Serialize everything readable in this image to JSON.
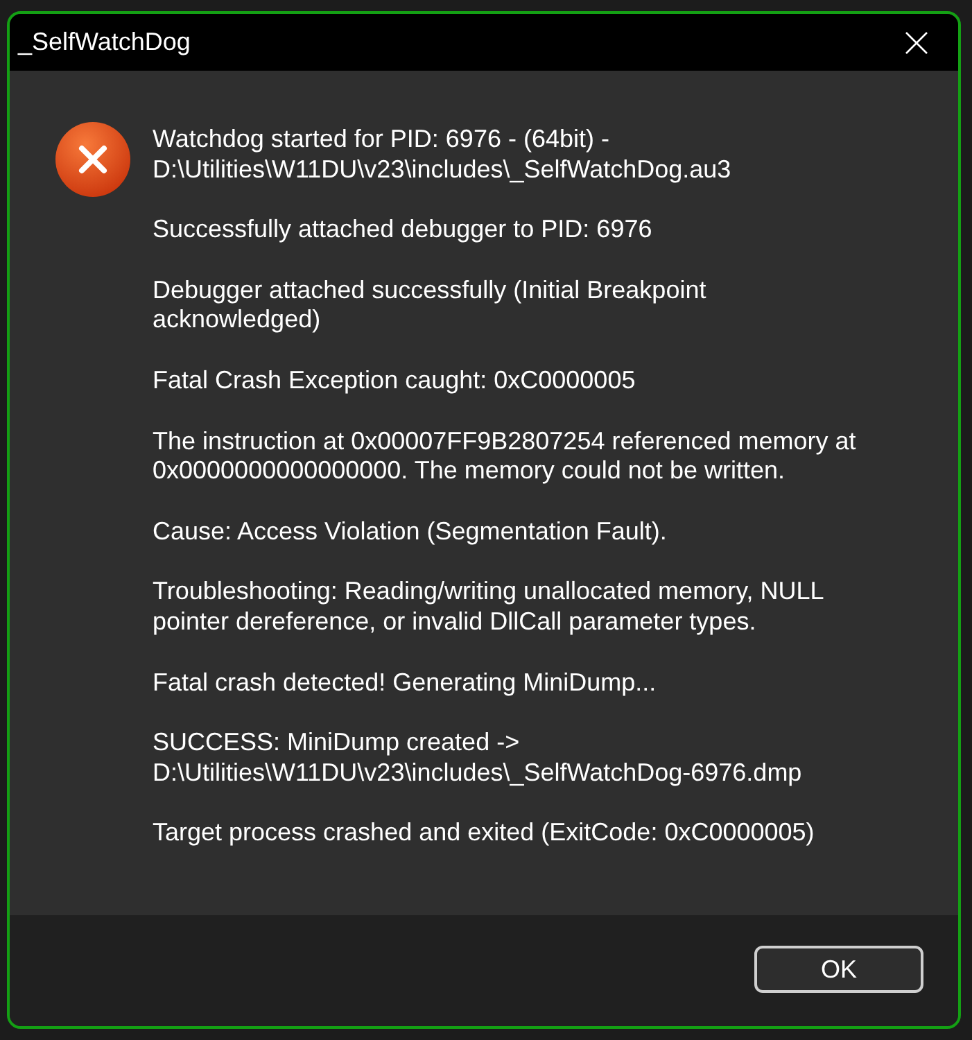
{
  "window": {
    "title": "_SelfWatchDog"
  },
  "message": {
    "paragraphs": [
      "Watchdog started for PID: 6976 - (64bit) - D:\\Utilities\\W11DU\\v23\\includes\\_SelfWatchDog.au3",
      "Successfully attached debugger to PID: 6976",
      "Debugger attached successfully (Initial Breakpoint acknowledged)",
      "Fatal Crash Exception caught: 0xC0000005",
      "The instruction at 0x00007FF9B2807254 referenced memory at 0x0000000000000000. The memory could not be written.",
      "Cause: Access Violation (Segmentation Fault).",
      "Troubleshooting: Reading/writing unallocated memory, NULL pointer dereference, or invalid DllCall parameter types.",
      "Fatal crash detected! Generating MiniDump...",
      "SUCCESS: MiniDump created -> D:\\Utilities\\W11DU\\v23\\includes\\_SelfWatchDog-6976.dmp",
      "Target process crashed and exited (ExitCode: 0xC0000005)"
    ]
  },
  "buttons": [
    "OK"
  ]
}
